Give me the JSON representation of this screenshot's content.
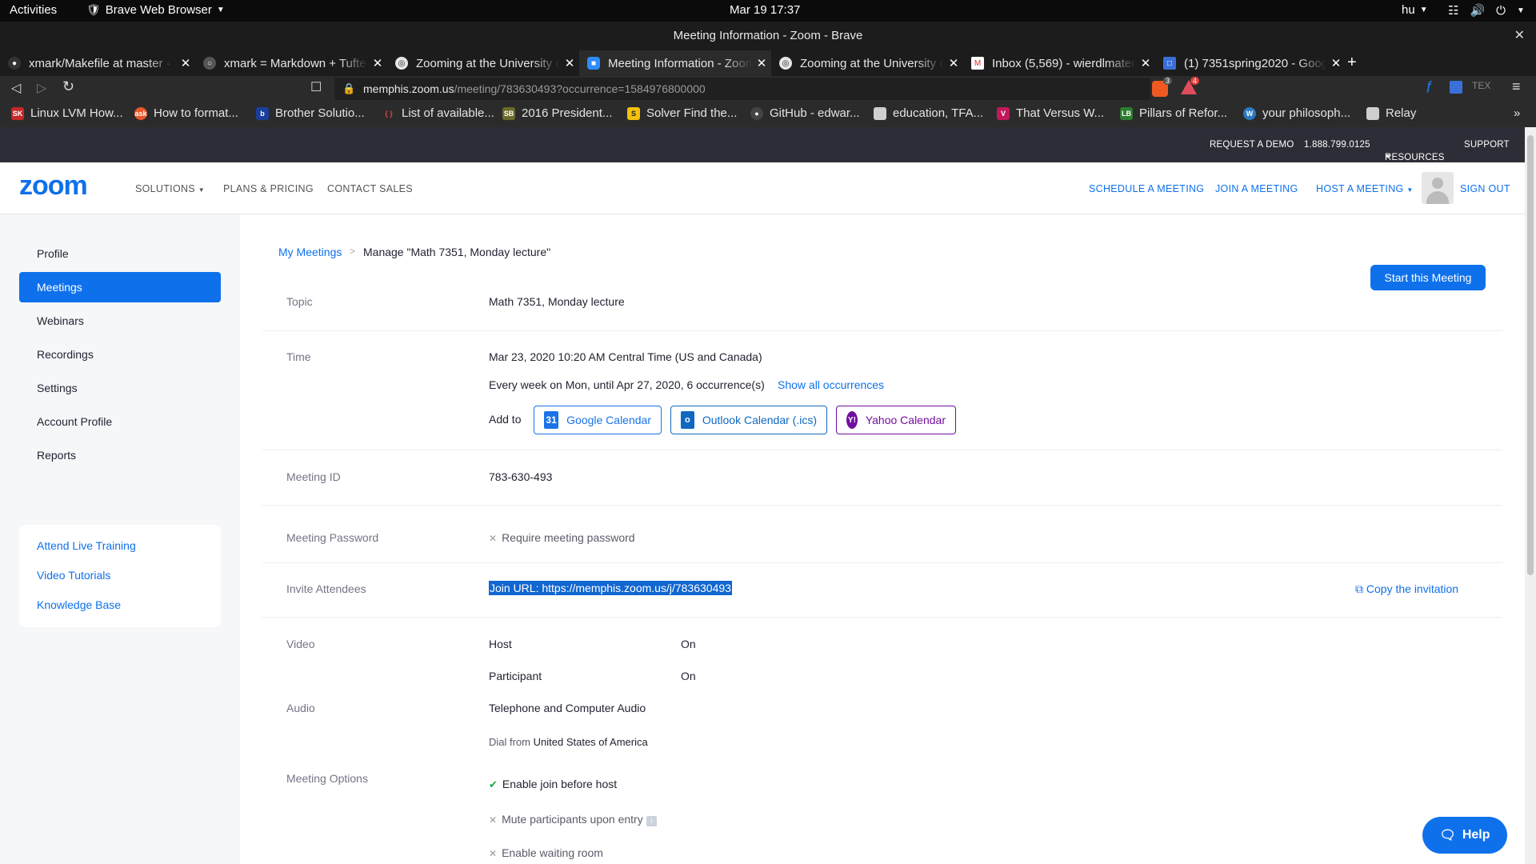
{
  "gnome": {
    "activities": "Activities",
    "app_name": "Brave Web Browser",
    "clock": "Mar 19  17:37",
    "lang": "hu"
  },
  "window": {
    "title": "Meeting Information - Zoom - Brave"
  },
  "tabs": [
    {
      "title": "xmark/Makefile at master · "
    },
    {
      "title": "xmark = Markdown + Tufte"
    },
    {
      "title": "Zooming at the University o"
    },
    {
      "title": "Meeting Information - Zoom"
    },
    {
      "title": "Zooming at the University o"
    },
    {
      "title": "Inbox (5,569) - wierdlmater"
    },
    {
      "title": "(1) 7351spring2020 - Goog"
    }
  ],
  "address": {
    "domain": "memphis.zoom.us",
    "path": "/meeting/783630493?occurrence=1584976800000",
    "shield_count": "3",
    "rewards_count": "4"
  },
  "bookmarks": [
    {
      "label": "Linux LVM How..."
    },
    {
      "label": "How to format..."
    },
    {
      "label": "Brother Solutio..."
    },
    {
      "label": "List of available..."
    },
    {
      "label": "2016 President..."
    },
    {
      "label": "Solver Find the..."
    },
    {
      "label": "GitHub - edwar..."
    },
    {
      "label": "education, TFA..."
    },
    {
      "label": "That Versus W..."
    },
    {
      "label": "Pillars of Refor..."
    },
    {
      "label": "your philosoph..."
    },
    {
      "label": "Relay"
    }
  ],
  "zoom_top": {
    "request_demo": "REQUEST A DEMO",
    "phone": "1.888.799.0125",
    "resources": "RESOURCES",
    "support": "SUPPORT"
  },
  "zoom_nav": {
    "logo": "zoom",
    "solutions": "SOLUTIONS",
    "plans": "PLANS & PRICING",
    "contact": "CONTACT SALES",
    "schedule": "SCHEDULE A MEETING",
    "join": "JOIN A MEETING",
    "host": "HOST A MEETING",
    "signout": "SIGN OUT"
  },
  "sidebar": {
    "items": [
      {
        "label": "Profile"
      },
      {
        "label": "Meetings"
      },
      {
        "label": "Webinars"
      },
      {
        "label": "Recordings"
      },
      {
        "label": "Settings"
      },
      {
        "label": "Account Profile"
      },
      {
        "label": "Reports"
      }
    ],
    "links": [
      {
        "label": "Attend Live Training"
      },
      {
        "label": "Video Tutorials"
      },
      {
        "label": "Knowledge Base"
      }
    ]
  },
  "main": {
    "breadcrumb_root": "My Meetings",
    "breadcrumb_current": "Manage \"Math 7351, Monday lecture\"",
    "start_button": "Start this Meeting",
    "topic_label": "Topic",
    "topic_value": "Math 7351, Monday lecture",
    "time_label": "Time",
    "time_value": "Mar 23, 2020 10:20 AM Central Time (US and Canada)",
    "recurrence": "Every week on Mon, until Apr 27, 2020, 6 occurrence(s)",
    "show_all": "Show all occurrences",
    "add_to": "Add to",
    "google_cal": "Google Calendar",
    "google_cal_day": "31",
    "outlook_cal": "Outlook Calendar (.ics)",
    "yahoo_cal": "Yahoo Calendar",
    "meeting_id_label": "Meeting ID",
    "meeting_id": "783-630-493",
    "password_label": "Meeting Password",
    "password_value": "Require meeting password",
    "invite_label": "Invite Attendees",
    "join_url": "Join URL: https://memphis.zoom.us/j/783630493",
    "copy_invitation": "Copy the invitation",
    "video_label": "Video",
    "host_label": "Host",
    "host_value": "On",
    "participant_label": "Participant",
    "participant_value": "On",
    "audio_label": "Audio",
    "audio_value": "Telephone and Computer Audio",
    "dial_from_prefix": "Dial from",
    "dial_from_country": "United States of America",
    "options_label": "Meeting Options",
    "options": [
      {
        "label": "Enable join before host",
        "enabled": true
      },
      {
        "label": "Mute participants upon entry",
        "enabled": false
      },
      {
        "label": "Enable waiting room",
        "enabled": false
      }
    ],
    "help_button": "Help"
  },
  "colors": {
    "zoom_blue": "#0e71eb",
    "header_dark": "#2d2d37",
    "google_blue": "#1a73e8",
    "outlook_blue": "#0f68c1",
    "yahoo_purple": "#720e9e"
  }
}
